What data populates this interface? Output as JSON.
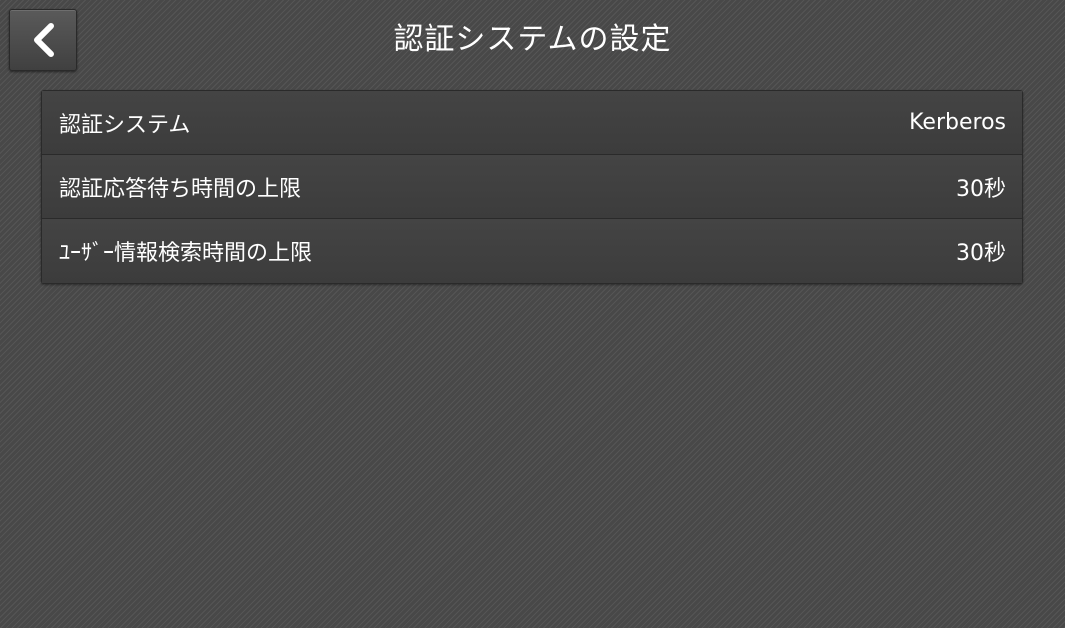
{
  "header": {
    "title": "認証システムの設定",
    "back_icon": "chevron-left-icon"
  },
  "settings": {
    "items": [
      {
        "label": "認証システム",
        "value": "Kerberos"
      },
      {
        "label": "認証応答待ち時間の上限",
        "value": "30秒"
      },
      {
        "label": "ﾕｰｻﾞｰ情報検索時間の上限",
        "value": "30秒"
      }
    ]
  },
  "colors": {
    "background": "#484848",
    "row": "#404040",
    "text": "#ffffff",
    "border": "#2a2a2a"
  }
}
